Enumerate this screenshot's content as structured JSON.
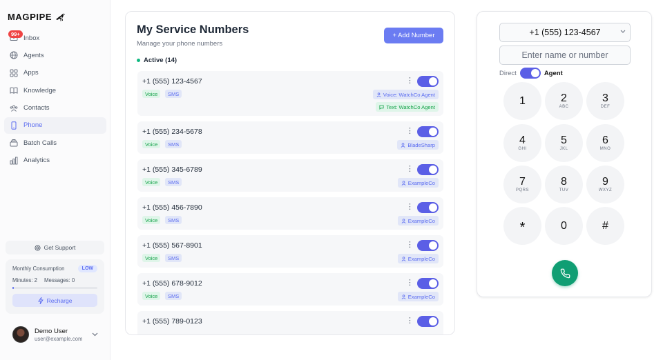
{
  "app": {
    "logo_text": "MAGPIPE"
  },
  "sidebar": {
    "items": [
      {
        "label": "Inbox",
        "icon": "mail-icon",
        "badge": "99+"
      },
      {
        "label": "Agents",
        "icon": "globe-icon"
      },
      {
        "label": "Apps",
        "icon": "grid-icon"
      },
      {
        "label": "Knowledge",
        "icon": "book-icon"
      },
      {
        "label": "Contacts",
        "icon": "users-icon"
      },
      {
        "label": "Phone",
        "icon": "phone-icon",
        "active": true
      },
      {
        "label": "Batch Calls",
        "icon": "layers-icon"
      },
      {
        "label": "Analytics",
        "icon": "bar-chart-icon"
      }
    ],
    "support_label": "Get Support",
    "consumption": {
      "title": "Monthly Consumption",
      "level": "LOW",
      "minutes": "Minutes: 2",
      "messages": "Messages: 0",
      "progress_fraction": 0.02,
      "recharge_label": "Recharge"
    },
    "user": {
      "name": "Demo User",
      "email": "user@example.com"
    }
  },
  "main": {
    "title": "My Service Numbers",
    "subtitle": "Manage your phone numbers",
    "add_button": "+ Add Number",
    "active_label": "Active (14)",
    "numbers": [
      {
        "number": "+1 (555) 123-4567",
        "tags": [
          "Voice",
          "SMS"
        ],
        "enabled": true,
        "agents": [
          {
            "label": "Voice: WatchCo Agent",
            "style": "blue"
          },
          {
            "label": "Text: WatchCo Agent",
            "style": "green"
          }
        ]
      },
      {
        "number": "+1 (555) 234-5678",
        "tags": [
          "Voice",
          "SMS"
        ],
        "enabled": true,
        "agents": [
          {
            "label": "BladeSharp",
            "style": "blue"
          }
        ]
      },
      {
        "number": "+1 (555) 345-6789",
        "tags": [
          "Voice",
          "SMS"
        ],
        "enabled": true,
        "agents": [
          {
            "label": "ExampleCo",
            "style": "blue"
          }
        ]
      },
      {
        "number": "+1 (555) 456-7890",
        "tags": [
          "Voice",
          "SMS"
        ],
        "enabled": true,
        "agents": [
          {
            "label": "ExampleCo",
            "style": "blue"
          }
        ]
      },
      {
        "number": "+1 (555) 567-8901",
        "tags": [
          "Voice",
          "SMS"
        ],
        "enabled": true,
        "agents": [
          {
            "label": "ExampleCo",
            "style": "blue"
          }
        ]
      },
      {
        "number": "+1 (555) 678-9012",
        "tags": [
          "Voice",
          "SMS"
        ],
        "enabled": true,
        "agents": [
          {
            "label": "ExampleCo",
            "style": "blue"
          }
        ]
      },
      {
        "number": "+1 (555) 789-0123",
        "tags": [],
        "enabled": true,
        "agents": []
      }
    ]
  },
  "dialer": {
    "selected_number": "+1 (555) 123-4567",
    "input_placeholder": "Enter name or number",
    "mode_direct": "Direct",
    "mode_agent": "Agent",
    "keys": [
      {
        "digit": "1",
        "letters": ""
      },
      {
        "digit": "2",
        "letters": "ABC"
      },
      {
        "digit": "3",
        "letters": "DEF"
      },
      {
        "digit": "4",
        "letters": "GHI"
      },
      {
        "digit": "5",
        "letters": "JKL"
      },
      {
        "digit": "6",
        "letters": "MNO"
      },
      {
        "digit": "7",
        "letters": "PQRS"
      },
      {
        "digit": "8",
        "letters": "TUV"
      },
      {
        "digit": "9",
        "letters": "WXYZ"
      },
      {
        "digit": "*",
        "letters": ""
      },
      {
        "digit": "0",
        "letters": ""
      },
      {
        "digit": "#",
        "letters": ""
      }
    ],
    "call_icon": "phone-call-icon"
  },
  "colors": {
    "accent": "#5b6cf0",
    "call_green": "#109e73",
    "active_dot": "#10b981",
    "badge_red": "#ef4444"
  }
}
